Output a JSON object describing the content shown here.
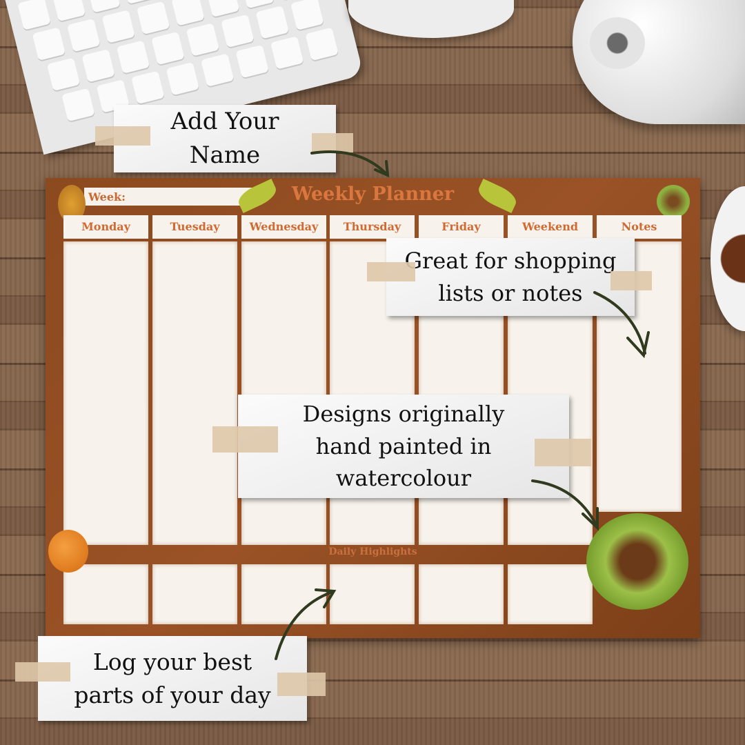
{
  "planner": {
    "title": "Weekly Planner",
    "week_label": "Week:",
    "columns": [
      "Monday",
      "Tuesday",
      "Wednesday",
      "Thursday",
      "Friday",
      "Weekend",
      "Notes"
    ],
    "highlights_label": "Daily Highlights"
  },
  "callouts": {
    "name": "Add Your Name",
    "notes": "Great for shopping lists or notes",
    "designs": "Designs originally hand painted in watercolour",
    "highlights": "Log your best parts of your day"
  },
  "colors": {
    "planner_bg": "#9a5226",
    "accent": "#d9773f",
    "paper": "#f7f3ec",
    "arrow": "#2f3a1e"
  }
}
